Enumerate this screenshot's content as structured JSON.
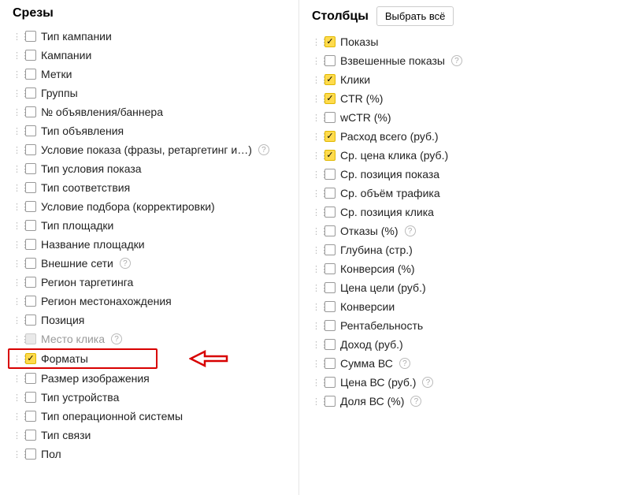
{
  "left": {
    "title": "Срезы",
    "items": [
      {
        "label": "Тип кампании",
        "checked": false,
        "disabled": false,
        "help": false
      },
      {
        "label": "Кампании",
        "checked": false,
        "disabled": false,
        "help": false
      },
      {
        "label": "Метки",
        "checked": false,
        "disabled": false,
        "help": false
      },
      {
        "label": "Группы",
        "checked": false,
        "disabled": false,
        "help": false
      },
      {
        "label": "№ объявления/баннера",
        "checked": false,
        "disabled": false,
        "help": false
      },
      {
        "label": "Тип объявления",
        "checked": false,
        "disabled": false,
        "help": false
      },
      {
        "label": "Условие показа (фразы, ретаргетинг и…)",
        "checked": false,
        "disabled": false,
        "help": true
      },
      {
        "label": "Тип условия показа",
        "checked": false,
        "disabled": false,
        "help": false
      },
      {
        "label": "Тип соответствия",
        "checked": false,
        "disabled": false,
        "help": false
      },
      {
        "label": "Условие подбора (корректировки)",
        "checked": false,
        "disabled": false,
        "help": false
      },
      {
        "label": "Тип площадки",
        "checked": false,
        "disabled": false,
        "help": false
      },
      {
        "label": "Название площадки",
        "checked": false,
        "disabled": false,
        "help": false
      },
      {
        "label": "Внешние сети",
        "checked": false,
        "disabled": false,
        "help": true
      },
      {
        "label": "Регион таргетинга",
        "checked": false,
        "disabled": false,
        "help": false
      },
      {
        "label": "Регион местонахождения",
        "checked": false,
        "disabled": false,
        "help": false
      },
      {
        "label": "Позиция",
        "checked": false,
        "disabled": false,
        "help": false
      },
      {
        "label": "Место клика",
        "checked": false,
        "disabled": true,
        "help": true
      },
      {
        "label": "Форматы",
        "checked": true,
        "disabled": false,
        "help": false,
        "highlight": true
      },
      {
        "label": "Размер изображения",
        "checked": false,
        "disabled": false,
        "help": false
      },
      {
        "label": "Тип устройства",
        "checked": false,
        "disabled": false,
        "help": false
      },
      {
        "label": "Тип операционной системы",
        "checked": false,
        "disabled": false,
        "help": false
      },
      {
        "label": "Тип связи",
        "checked": false,
        "disabled": false,
        "help": false
      },
      {
        "label": "Пол",
        "checked": false,
        "disabled": false,
        "help": false
      }
    ]
  },
  "right": {
    "title": "Столбцы",
    "select_all_label": "Выбрать всё",
    "items": [
      {
        "label": "Показы",
        "checked": true,
        "disabled": false,
        "help": false
      },
      {
        "label": "Взвешенные показы",
        "checked": false,
        "disabled": false,
        "help": true
      },
      {
        "label": "Клики",
        "checked": true,
        "disabled": false,
        "help": false
      },
      {
        "label": "CTR (%)",
        "checked": true,
        "disabled": false,
        "help": false
      },
      {
        "label": "wCTR (%)",
        "checked": false,
        "disabled": false,
        "help": false
      },
      {
        "label": "Расход всего (руб.)",
        "checked": true,
        "disabled": false,
        "help": false
      },
      {
        "label": "Ср. цена клика (руб.)",
        "checked": true,
        "disabled": false,
        "help": false
      },
      {
        "label": "Ср. позиция показа",
        "checked": false,
        "disabled": false,
        "help": false
      },
      {
        "label": "Ср. объём трафика",
        "checked": false,
        "disabled": false,
        "help": false
      },
      {
        "label": "Ср. позиция клика",
        "checked": false,
        "disabled": false,
        "help": false
      },
      {
        "label": "Отказы (%)",
        "checked": false,
        "disabled": false,
        "help": true
      },
      {
        "label": "Глубина (стр.)",
        "checked": false,
        "disabled": false,
        "help": false
      },
      {
        "label": "Конверсия (%)",
        "checked": false,
        "disabled": false,
        "help": false
      },
      {
        "label": "Цена цели (руб.)",
        "checked": false,
        "disabled": false,
        "help": false
      },
      {
        "label": "Конверсии",
        "checked": false,
        "disabled": false,
        "help": false
      },
      {
        "label": "Рентабельность",
        "checked": false,
        "disabled": false,
        "help": false
      },
      {
        "label": "Доход (руб.)",
        "checked": false,
        "disabled": false,
        "help": false
      },
      {
        "label": "Сумма ВС",
        "checked": false,
        "disabled": false,
        "help": true
      },
      {
        "label": "Цена ВС (руб.)",
        "checked": false,
        "disabled": false,
        "help": true
      },
      {
        "label": "Доля ВС (%)",
        "checked": false,
        "disabled": false,
        "help": true
      }
    ]
  },
  "help_glyph": "?",
  "check_glyph": "✓"
}
